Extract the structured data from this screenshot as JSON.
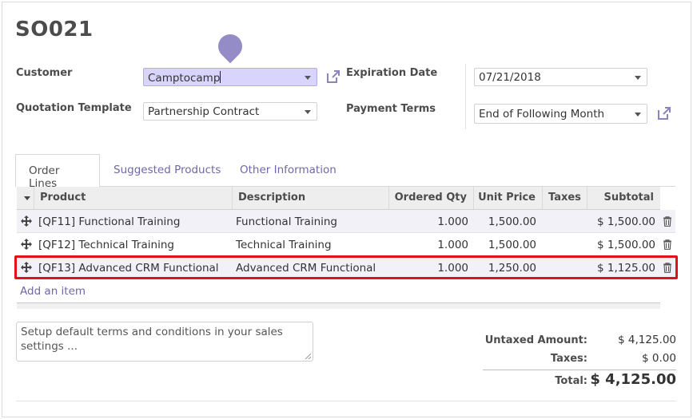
{
  "record": {
    "title": "SO021"
  },
  "form": {
    "customer_label": "Customer",
    "customer_value": "Camptocamp",
    "template_label": "Quotation Template",
    "template_value": "Partnership Contract",
    "expiration_label": "Expiration Date",
    "expiration_value": "07/21/2018",
    "payment_label": "Payment Terms",
    "payment_value": "End of Following Month"
  },
  "tabs": [
    {
      "label": "Order Lines"
    },
    {
      "label": "Suggested Products"
    },
    {
      "label": "Other Information"
    }
  ],
  "table": {
    "headers": {
      "product": "Product",
      "description": "Description",
      "qty": "Ordered Qty",
      "price": "Unit Price",
      "taxes": "Taxes",
      "subtotal": "Subtotal"
    },
    "rows": [
      {
        "product": "[QF11] Functional Training",
        "description": "Functional Training",
        "qty": "1.000",
        "price": "1,500.00",
        "taxes": "",
        "subtotal": "$ 1,500.00"
      },
      {
        "product": "[QF12] Technical Training",
        "description": "Technical Training",
        "qty": "1.000",
        "price": "1,500.00",
        "taxes": "",
        "subtotal": "$ 1,500.00"
      },
      {
        "product": "[QF13] Advanced CRM Functional",
        "description": "Advanced CRM Functional",
        "qty": "1.000",
        "price": "1,250.00",
        "taxes": "",
        "subtotal": "$ 1,125.00"
      }
    ],
    "add_item": "Add an item"
  },
  "notes": {
    "text": "Setup default terms and conditions in your sales settings ..."
  },
  "totals": {
    "untaxed_label": "Untaxed Amount:",
    "untaxed_value": "$ 4,125.00",
    "taxes_label": "Taxes:",
    "taxes_value": "$ 0.00",
    "total_label": "Total:",
    "total_value": "$ 4,125.00"
  },
  "colors": {
    "accent": "#6f68a6",
    "focus": "#d9d4fb",
    "highlight": "#e0131b"
  }
}
